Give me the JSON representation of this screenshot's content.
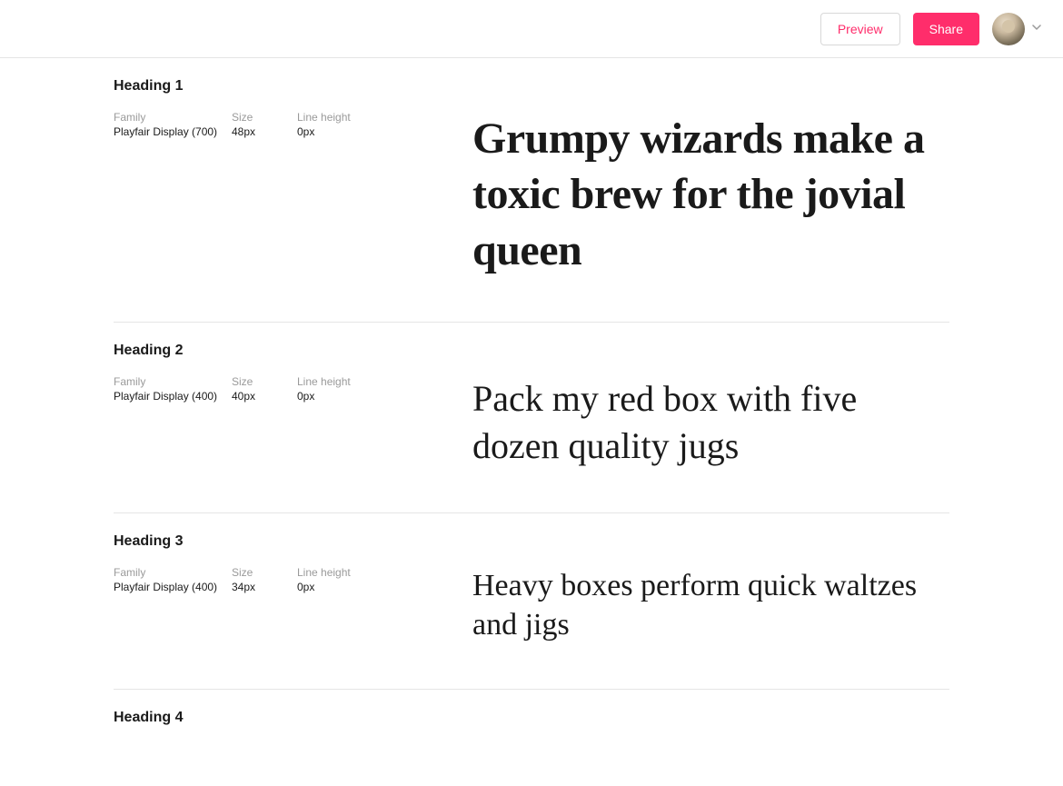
{
  "header": {
    "preview_label": "Preview",
    "share_label": "Share"
  },
  "metaLabels": {
    "family": "Family",
    "size": "Size",
    "lineheight": "Line height"
  },
  "sections": [
    {
      "title": "Heading 1",
      "family": "Playfair Display (700)",
      "size": "48px",
      "lineheight": "0px",
      "sample": "Grumpy wizards make a toxic brew for the jovial queen",
      "sampleClass": "sample-48"
    },
    {
      "title": "Heading 2",
      "family": "Playfair Display (400)",
      "size": "40px",
      "lineheight": "0px",
      "sample": "Pack my red box with five dozen quality jugs",
      "sampleClass": "sample-40"
    },
    {
      "title": "Heading 3",
      "family": "Playfair Display (400)",
      "size": "34px",
      "lineheight": "0px",
      "sample": "Heavy boxes perform quick waltzes and jigs",
      "sampleClass": "sample-34"
    },
    {
      "title": "Heading 4",
      "family": "",
      "size": "",
      "lineheight": "",
      "sample": "",
      "sampleClass": ""
    }
  ]
}
